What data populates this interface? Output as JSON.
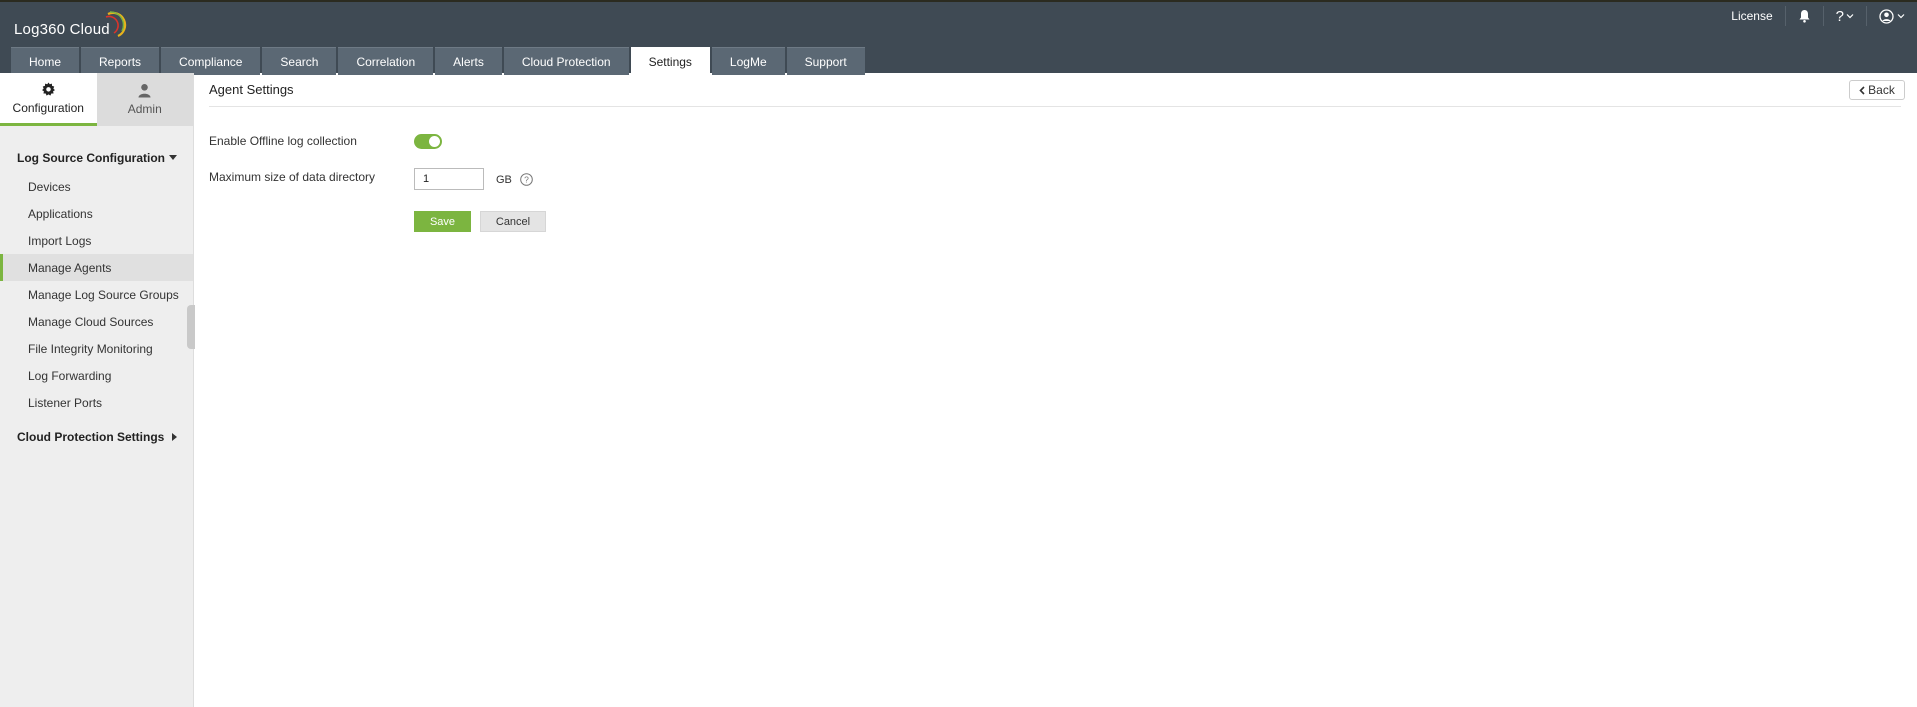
{
  "app": {
    "logo_text": "Log360  Cloud"
  },
  "header_right": {
    "license_label": "License",
    "icons": [
      "bell-icon",
      "help-icon",
      "user-icon"
    ],
    "help_glyph": "?"
  },
  "tabs": [
    {
      "label": "Home",
      "active": false
    },
    {
      "label": "Reports",
      "active": false
    },
    {
      "label": "Compliance",
      "active": false
    },
    {
      "label": "Search",
      "active": false
    },
    {
      "label": "Correlation",
      "active": false
    },
    {
      "label": "Alerts",
      "active": false
    },
    {
      "label": "Cloud Protection",
      "active": false
    },
    {
      "label": "Settings",
      "active": true
    },
    {
      "label": "LogMe",
      "active": false
    },
    {
      "label": "Support",
      "active": false
    }
  ],
  "sidebar": {
    "tabs": [
      {
        "label": "Configuration",
        "icon": "gear-icon",
        "active": true
      },
      {
        "label": "Admin",
        "icon": "user-icon",
        "active": false
      }
    ],
    "section1": "Log Source Configuration",
    "items": [
      {
        "label": "Devices",
        "active": false
      },
      {
        "label": "Applications",
        "active": false
      },
      {
        "label": "Import Logs",
        "active": false
      },
      {
        "label": "Manage Agents",
        "active": true
      },
      {
        "label": "Manage Log Source Groups",
        "active": false
      },
      {
        "label": "Manage Cloud Sources",
        "active": false
      },
      {
        "label": "File Integrity Monitoring",
        "active": false
      },
      {
        "label": "Log Forwarding",
        "active": false
      },
      {
        "label": "Listener Ports",
        "active": false
      }
    ],
    "section2": "Cloud Protection Settings"
  },
  "main": {
    "title": "Agent Settings",
    "back_label": "Back",
    "offline_label": "Enable Offline log collection",
    "offline_enabled": true,
    "max_size_label": "Maximum size of data directory",
    "max_size_value": "1",
    "unit": "GB",
    "save_label": "Save",
    "cancel_label": "Cancel"
  },
  "colors": {
    "header_bg": "#3f4a54",
    "tab_bg": "#5b6874",
    "accent_green": "#7cb540",
    "sidebar_bg": "#eeeeee"
  }
}
